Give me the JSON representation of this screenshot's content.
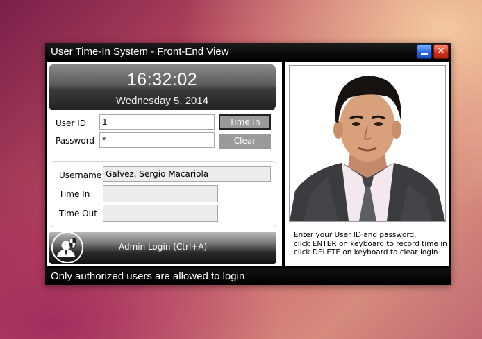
{
  "window": {
    "title": "User Time-In System - Front-End View",
    "minimize_label": "",
    "close_label": "✕"
  },
  "clock": {
    "time": "16:32:02",
    "date": "Wednesday 5, 2014"
  },
  "login": {
    "user_id_label": "User ID",
    "user_id_value": "1",
    "password_label": "Password",
    "password_value": "*",
    "time_in_button": "Time In",
    "clear_button": "Clear"
  },
  "info": {
    "username_label": "Username",
    "username_value": "Galvez, Sergio Macariola",
    "time_in_label": "Time In",
    "time_in_value": "",
    "time_out_label": "Time Out",
    "time_out_value": ""
  },
  "admin": {
    "label": "Admin Login (Ctrl+A)",
    "icon": "admin-shield-user-icon"
  },
  "instructions": [
    "Enter your User ID and password.",
    "click ENTER on keyboard to record time in",
    "click DELETE on keyboard to clear login"
  ],
  "status": {
    "text": "Only authorized users are allowed to login"
  },
  "colors": {
    "titlebar": "#000000",
    "button_gray": "#9a9a9a",
    "minimize_blue": "#2a66e0",
    "close_red": "#d3321b"
  }
}
